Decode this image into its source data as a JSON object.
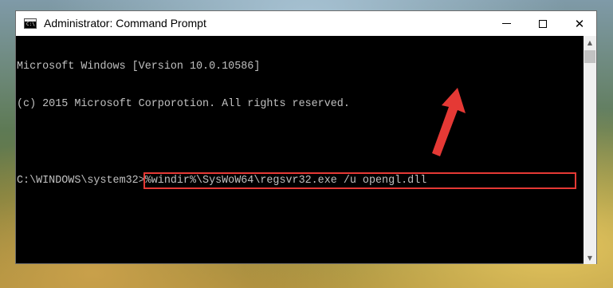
{
  "window": {
    "title": "Administrator: Command Prompt",
    "controls": {
      "minimize": "minimize",
      "maximize": "maximize",
      "close": "✕"
    }
  },
  "console": {
    "lines": [
      "Microsoft Windows [Version 10.0.10586]",
      "(c) 2015 Microsoft Corporotion. All rights reserved."
    ],
    "prompt": "C:\\WINDOWS\\system32>",
    "command": "%windir%\\SysWoW64\\regsvr32.exe /u opengl.dll"
  },
  "colors": {
    "highlight": "#e53935",
    "console_text": "#c0c0c0",
    "console_bg": "#000000",
    "arrow": "#e53935"
  },
  "icons": [
    "cmd-app-icon",
    "minimize-icon",
    "maximize-icon",
    "close-icon",
    "scroll-up-icon",
    "scroll-down-icon",
    "red-arrow-icon"
  ]
}
